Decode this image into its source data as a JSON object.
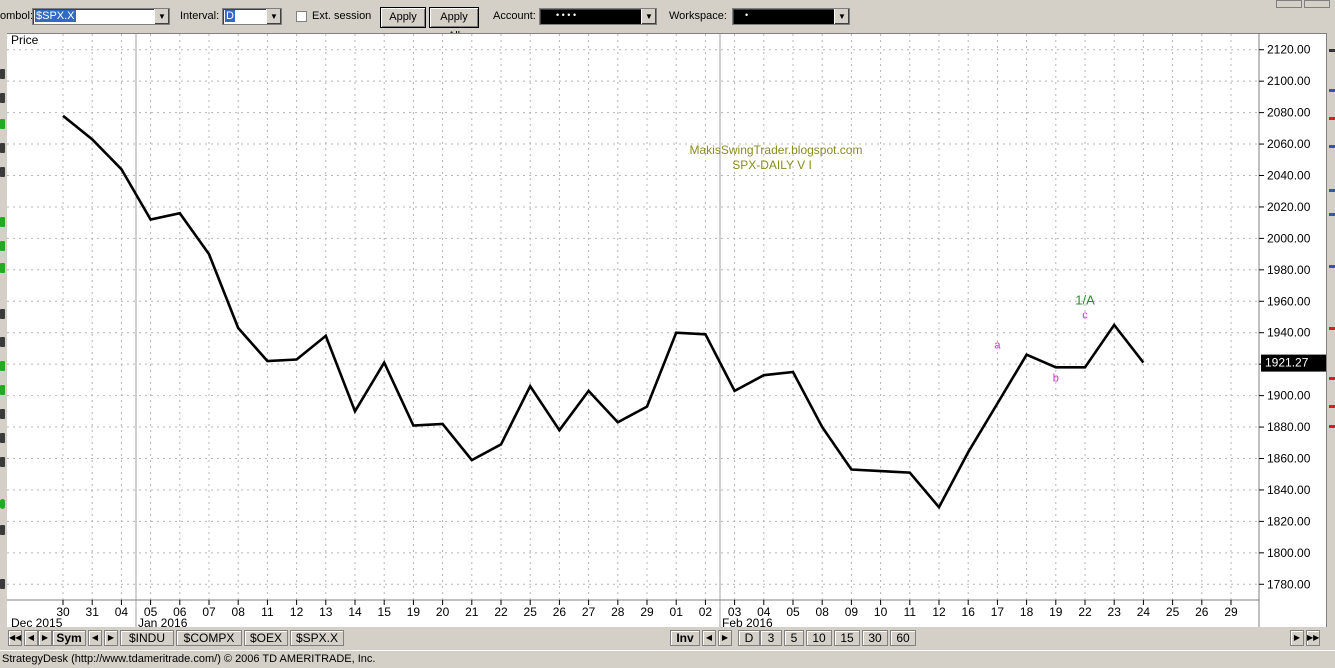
{
  "toolbar": {
    "symbol_label": "ombol:",
    "symbol_value": "$SPX.X",
    "interval_label": "Interval:",
    "interval_value": "D",
    "ext_session_label": "Ext. session",
    "apply_label": "Apply",
    "apply_all_label": "Apply All",
    "account_label": "Account:",
    "account_value": "•  •  •  •",
    "workspace_label": "Workspace:",
    "workspace_value": "•",
    "dropdown_icon": "chevron-down-icon"
  },
  "chart_panel": {
    "panel_label": "Price",
    "watermark_line1": "MakisSwingTrader.blogspot.com",
    "watermark_line2": "SPX-DAILY  V I",
    "last_price_label": "1921.27",
    "annotations": [
      {
        "text": "a",
        "x": "17",
        "y": 1930,
        "color": "#cc33cc"
      },
      {
        "text": "b",
        "x": "19",
        "y": 1909,
        "color": "#cc33cc"
      },
      {
        "text": "c",
        "x": "22",
        "y": 1949,
        "color": "#cc33cc"
      },
      {
        "text": "1/A",
        "x": "22",
        "y": 1958,
        "color": "#2e8b2e"
      }
    ],
    "month_labels": [
      {
        "text": "Dec 2015",
        "index": 0
      },
      {
        "text": "Jan 2016",
        "index": 3
      },
      {
        "text": "Feb 2016",
        "index": 23
      }
    ],
    "colors": {
      "line": "#000000",
      "watermark": "#8b8b1e",
      "grid": "#b4b4b4"
    }
  },
  "chart_data": {
    "type": "line",
    "title": "SPX-DAILY  V I",
    "xlabel": "",
    "ylabel": "Price",
    "x": [
      "30",
      "31",
      "04",
      "05",
      "06",
      "07",
      "08",
      "11",
      "12",
      "13",
      "14",
      "15",
      "19",
      "20",
      "21",
      "22",
      "25",
      "26",
      "27",
      "28",
      "29",
      "01",
      "02",
      "03",
      "04",
      "05",
      "08",
      "09",
      "10",
      "11",
      "12",
      "16",
      "17",
      "18",
      "19",
      "22",
      "23",
      "24",
      "25",
      "26",
      "29"
    ],
    "series": [
      {
        "values": [
          2078,
          2063,
          2044,
          2012,
          2016,
          1990,
          1943,
          1922,
          1923,
          1938,
          1890,
          1921,
          1881,
          1882,
          1859,
          1869,
          1906,
          1878,
          1903,
          1883,
          1893,
          1940,
          1939,
          1903,
          1913,
          1915,
          1880,
          1853,
          1852,
          1851,
          1829,
          1864,
          1895,
          1926,
          1918,
          1918,
          1945,
          1921
        ]
      }
    ],
    "ylim": [
      1770,
      2130
    ],
    "y_ticks": [
      1780,
      1800,
      1820,
      1840,
      1860,
      1880,
      1900,
      1920,
      1940,
      1960,
      1980,
      2000,
      2020,
      2040,
      2060,
      2080,
      2100,
      2120
    ],
    "y_tick_labels": [
      "1780.00",
      "1800.00",
      "1820.00",
      "1840.00",
      "1860.00",
      "1880.00",
      "1900.00",
      "1920.00",
      "1940.00",
      "1960.00",
      "1980.00",
      "2000.00",
      "2020.00",
      "2040.00",
      "2060.00",
      "2080.00",
      "2100.00",
      "2120.00"
    ],
    "grid": true,
    "axis_side": "right"
  },
  "tabs": {
    "sym_label": "Sym",
    "symbols": [
      "$INDU",
      "$COMPX",
      "$OEX",
      "$SPX.X"
    ],
    "inv_label": "Inv",
    "intervals": [
      "D",
      "3",
      "5",
      "10",
      "15",
      "30",
      "60"
    ]
  },
  "status": {
    "text": "StrategyDesk (http://www.tdameritrade.com/) © 2006 TD AMERITRADE, Inc."
  }
}
